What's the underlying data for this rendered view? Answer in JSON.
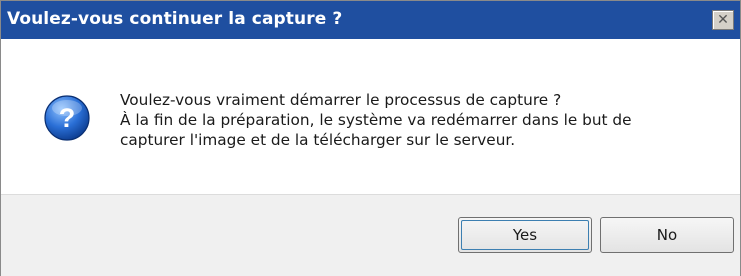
{
  "window": {
    "title": "Voulez-vous continuer la capture ?",
    "close_glyph": "✕",
    "titlebar_color": "#1f4fa0"
  },
  "message": {
    "icon": "question-icon",
    "lines": [
      "Voulez-vous vraiment démarrer le processus de capture ?",
      "À la fin de la préparation, le système va redémarrer dans le but de",
      "capturer l'image et de la télécharger sur le serveur."
    ]
  },
  "buttons": {
    "yes_label": "Yes",
    "no_label": "No"
  }
}
